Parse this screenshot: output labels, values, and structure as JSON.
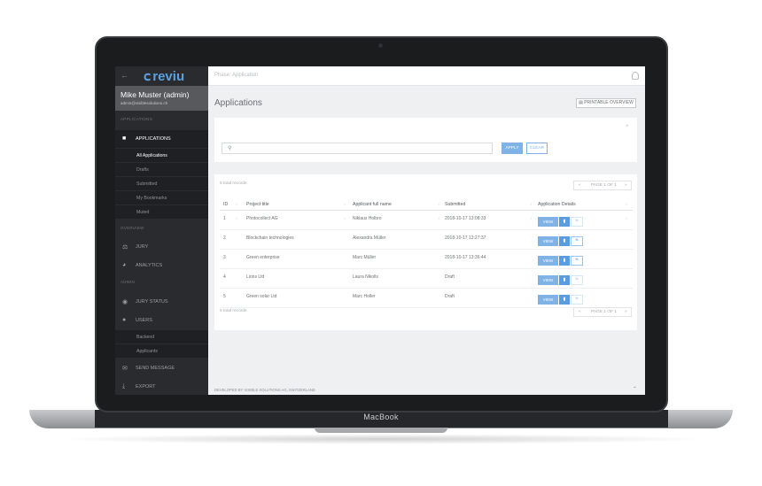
{
  "device": {
    "brand": "MacBook"
  },
  "app": {
    "logo": "reviu",
    "phase": "Phase: Application"
  },
  "profile": {
    "name": "Mike Muster (admin)",
    "email": "admin@visiblesolutions.ch"
  },
  "sidebar": {
    "sections": {
      "applications": "APPLICATIONS",
      "overview": "OVERVIEW",
      "admin": "ADMIN"
    },
    "applications": "APPLICATIONS",
    "sub_applications": [
      "All Applications",
      "Drafts",
      "Submitted",
      "My Bookmarks",
      "Muted"
    ],
    "jury": "JURY",
    "analytics": "ANALYTICS",
    "jury_status": "JURY STATUS",
    "users": "USERS",
    "sub_users": [
      "Backend",
      "Applicants"
    ],
    "send_message": "SEND MESSAGE",
    "export": "EXPORT"
  },
  "page": {
    "title": "Applications",
    "print_label": "PRINTABLE OVERVIEW"
  },
  "filter": {
    "search_placeholder": "",
    "apply": "APPLY",
    "clear": "CLEAR",
    "close": "×"
  },
  "table": {
    "total": "5 total records",
    "pager": {
      "prev": "«",
      "label": "PAGE 1 OF 1",
      "next": "»"
    },
    "headers": [
      "ID",
      "Project title",
      "Applicant full name",
      "Submitted",
      "Application Details"
    ],
    "rows": [
      {
        "id": "1",
        "title": "Photocollect AG",
        "applicant": "Niklaus Holbro",
        "submitted": "2018-10-17 13:08:33"
      },
      {
        "id": "2",
        "title": "Blockchain technologies",
        "applicant": "Alexandra Müller",
        "submitted": "2018-10-17 13:27:37"
      },
      {
        "id": "3",
        "title": "Green enterprise",
        "applicant": "Marc Müller",
        "submitted": "2018-10-17 13:36:44"
      },
      {
        "id": "4",
        "title": "Lions Ltd",
        "applicant": "Laura Nikolls",
        "submitted": "Draft"
      },
      {
        "id": "5",
        "title": "Green solar Ltd",
        "applicant": "Marc Holler",
        "submitted": "Draft"
      }
    ],
    "view_label": "VIEW"
  },
  "footer": {
    "text": "DEVELOPED BY VISIBLE SOLUTIONS AG, SWITZERLAND"
  },
  "colors": {
    "accent": "#7fb3e6",
    "sidebar": "#2a2b2e",
    "logo": "#5aa1e0"
  }
}
